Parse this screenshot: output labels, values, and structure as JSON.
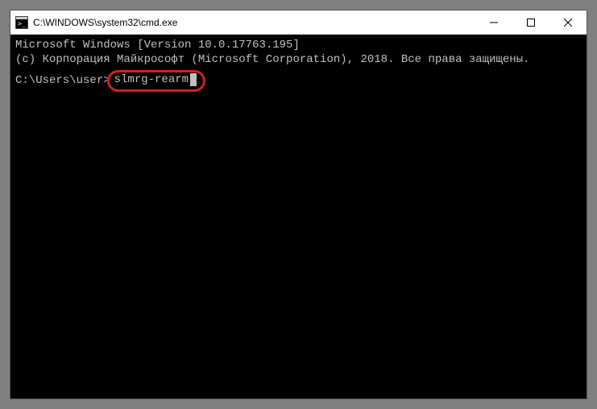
{
  "titlebar": {
    "title": "C:\\WINDOWS\\system32\\cmd.exe"
  },
  "terminal": {
    "line1": "Microsoft Windows [Version 10.0.17763.195]",
    "line2": "(c) Корпорация Майкрософт (Microsoft Corporation), 2018. Все права защищены.",
    "blank": "",
    "prompt": "C:\\Users\\user>",
    "command": "slmrg-rearm"
  }
}
